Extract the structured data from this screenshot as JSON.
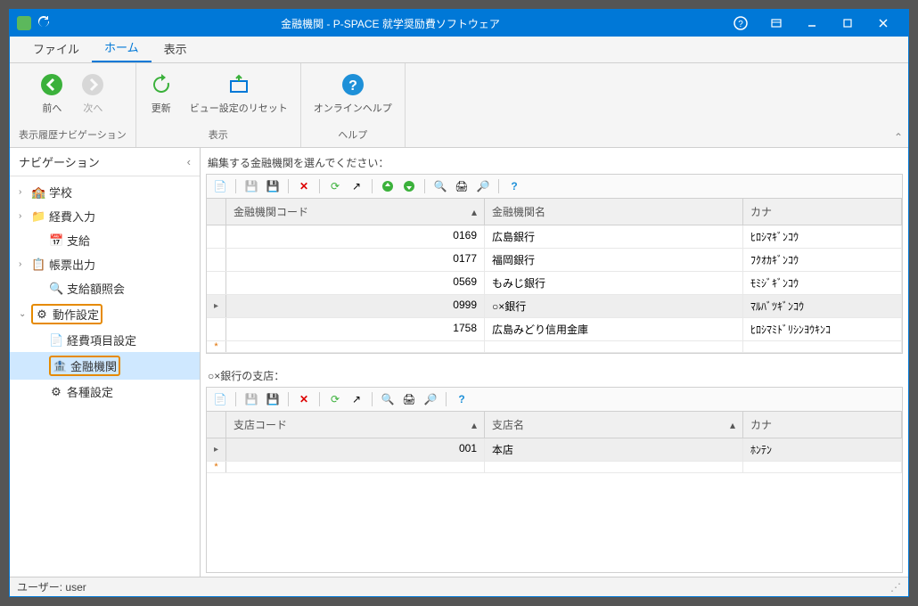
{
  "title": "金融機関 - P-SPACE 就学奨励費ソフトウェア",
  "menu": {
    "file": "ファイル",
    "home": "ホーム",
    "view": "表示"
  },
  "ribbon": {
    "nav": {
      "back": "前へ",
      "forward": "次へ",
      "group": "表示履歴ナビゲーション"
    },
    "display": {
      "refresh": "更新",
      "reset": "ビュー設定のリセット",
      "group": "表示"
    },
    "help": {
      "online": "オンラインヘルプ",
      "group": "ヘルプ"
    }
  },
  "nav": {
    "title": "ナビゲーション",
    "items": [
      {
        "label": "学校",
        "icon": "🏫",
        "arrow": "›",
        "level": 1
      },
      {
        "label": "経費入力",
        "icon": "📁",
        "arrow": "›",
        "level": 1
      },
      {
        "label": "支給",
        "icon": "📅",
        "arrow": "",
        "level": 2
      },
      {
        "label": "帳票出力",
        "icon": "📋",
        "arrow": "›",
        "level": 1
      },
      {
        "label": "支給額照会",
        "icon": "🔍",
        "arrow": "",
        "level": 2
      },
      {
        "label": "動作設定",
        "icon": "⚙",
        "arrow": "⌄",
        "level": 1,
        "highlight": true
      },
      {
        "label": "経費項目設定",
        "icon": "📄",
        "arrow": "",
        "level": 2
      },
      {
        "label": "金融機関",
        "icon": "🏦",
        "arrow": "",
        "level": 2,
        "selected": true,
        "highlight": true
      },
      {
        "label": "各種設定",
        "icon": "⚙",
        "arrow": "",
        "level": 2
      }
    ]
  },
  "main": {
    "bank_prompt": "編集する金融機関を選んでください：",
    "bank_cols": {
      "code": "金融機関コード",
      "name": "金融機関名",
      "kana": "カナ"
    },
    "banks": [
      {
        "code": "0169",
        "name": "広島銀行",
        "kana": "ﾋﾛｼﾏｷﾞﾝｺｳ"
      },
      {
        "code": "0177",
        "name": "福岡銀行",
        "kana": "ﾌｸｵｶｷﾞﾝｺｳ"
      },
      {
        "code": "0569",
        "name": "もみじ銀行",
        "kana": "ﾓﾐｼﾞｷﾞﾝｺｳ"
      },
      {
        "code": "0999",
        "name": "○×銀行",
        "kana": "ﾏﾙﾊﾞﾂｷﾞﾝｺｳ",
        "selected": true
      },
      {
        "code": "1758",
        "name": "広島みどり信用金庫",
        "kana": "ﾋﾛｼﾏﾐﾄﾞﾘｼﾝﾖｳｷﾝｺ"
      }
    ],
    "branch_prompt": "○×銀行の支店：",
    "branch_cols": {
      "code": "支店コード",
      "name": "支店名",
      "kana": "カナ"
    },
    "branches": [
      {
        "code": "001",
        "name": "本店",
        "kana": "ﾎﾝﾃﾝ",
        "selected": true
      }
    ]
  },
  "status": {
    "user": "ユーザー: user"
  }
}
